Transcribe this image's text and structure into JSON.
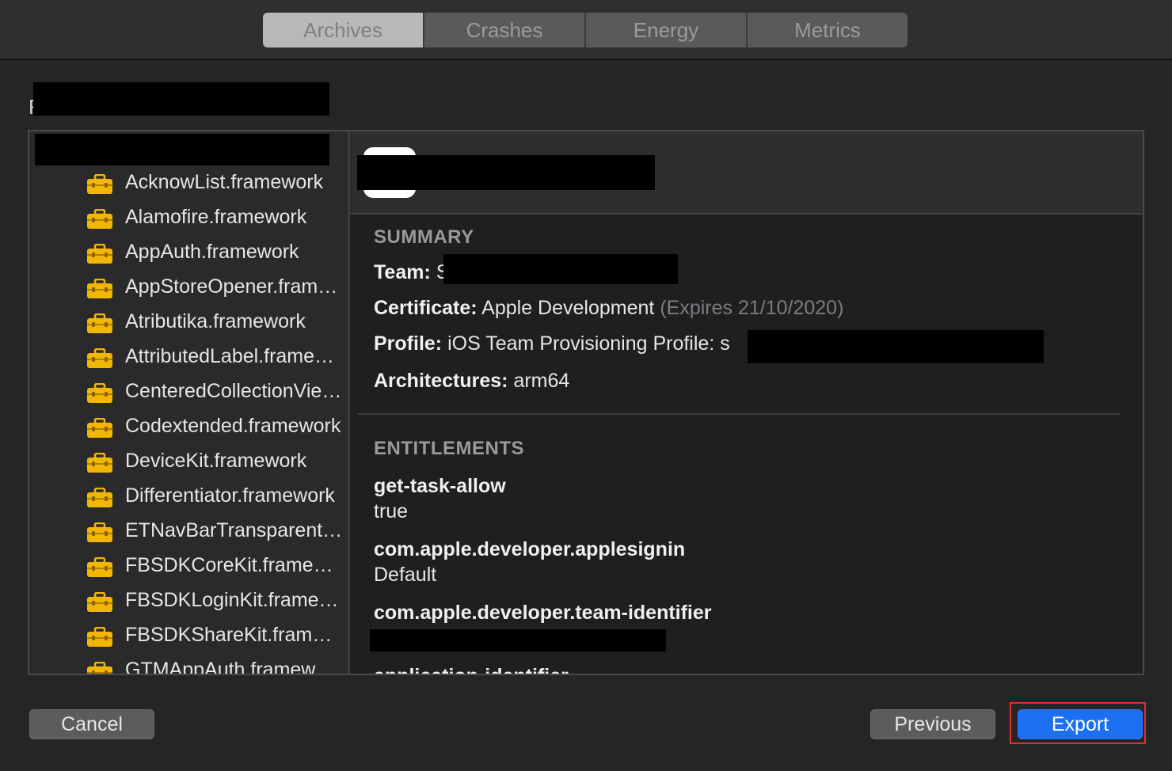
{
  "tabs": [
    {
      "label": "Archives",
      "active": true
    },
    {
      "label": "Crashes",
      "active": false
    },
    {
      "label": "Energy",
      "active": false
    },
    {
      "label": "Metrics",
      "active": false
    }
  ],
  "header_prefix": "F",
  "sidebar": {
    "items": [
      {
        "label": "AcknowList.framework",
        "icon": "toolbox-icon"
      },
      {
        "label": "Alamofire.framework",
        "icon": "toolbox-icon"
      },
      {
        "label": "AppAuth.framework",
        "icon": "toolbox-icon"
      },
      {
        "label": "AppStoreOpener.framework",
        "icon": "toolbox-icon"
      },
      {
        "label": "Atributika.framework",
        "icon": "toolbox-icon"
      },
      {
        "label": "AttributedLabel.framework",
        "icon": "toolbox-icon"
      },
      {
        "label": "CenteredCollectionView.framework",
        "icon": "toolbox-icon"
      },
      {
        "label": "Codextended.framework",
        "icon": "toolbox-icon"
      },
      {
        "label": "DeviceKit.framework",
        "icon": "toolbox-icon"
      },
      {
        "label": "Differentiator.framework",
        "icon": "toolbox-icon"
      },
      {
        "label": "ETNavBarTransparent.framework",
        "icon": "toolbox-icon"
      },
      {
        "label": "FBSDKCoreKit.framework",
        "icon": "toolbox-icon"
      },
      {
        "label": "FBSDKLoginKit.framework",
        "icon": "toolbox-icon"
      },
      {
        "label": "FBSDKShareKit.framework",
        "icon": "toolbox-icon"
      },
      {
        "label": "GTMAppAuth.framework",
        "icon": "toolbox-icon"
      }
    ]
  },
  "summary": {
    "title": "SUMMARY",
    "team_label": "Team:",
    "team_value_prefix": "S",
    "certificate_label": "Certificate:",
    "certificate_value": "Apple Development",
    "certificate_expiry": "(Expires 21/10/2020)",
    "profile_label": "Profile:",
    "profile_value": "iOS Team Provisioning Profile: s",
    "architectures_label": "Architectures:",
    "architectures_value": "arm64"
  },
  "entitlements": {
    "title": "ENTITLEMENTS",
    "items": [
      {
        "key": "get-task-allow",
        "value": "true"
      },
      {
        "key": "com.apple.developer.applesignin",
        "value": "Default"
      },
      {
        "key": "com.apple.developer.team-identifier",
        "value": ""
      },
      {
        "key": "application-identifier",
        "value": ""
      }
    ]
  },
  "buttons": {
    "cancel": "Cancel",
    "previous": "Previous",
    "export": "Export"
  },
  "colors": {
    "accent": "#1d6ff2",
    "focus_ring": "#e0302a",
    "toolbox_icon": "#f2b705"
  }
}
